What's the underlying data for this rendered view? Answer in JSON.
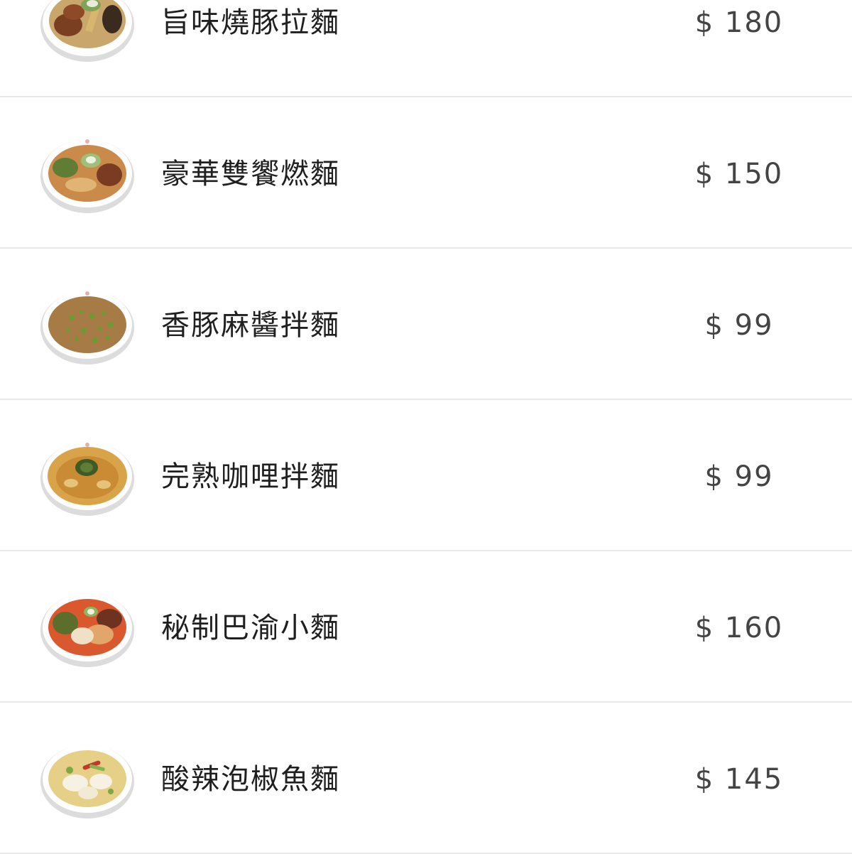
{
  "menu": {
    "items": [
      {
        "name": "旨味燒豚拉麵",
        "price": "$ 180",
        "image": "ramen-bowl-icon"
      },
      {
        "name": "豪華雙饗燃麵",
        "price": "$ 150",
        "image": "noodle-bowl-icon"
      },
      {
        "name": "香豚麻醬拌麵",
        "price": "$ 99",
        "image": "noodle-bowl-icon"
      },
      {
        "name": "完熟咖哩拌麵",
        "price": "$ 99",
        "image": "curry-noodle-bowl-icon"
      },
      {
        "name": "秘制巴渝小麵",
        "price": "$ 160",
        "image": "spicy-noodle-bowl-icon"
      },
      {
        "name": "酸辣泡椒魚麵",
        "price": "$ 145",
        "image": "fish-soup-bowl-icon"
      }
    ]
  },
  "colors": {
    "name_text": "#1f1f1f",
    "price_text": "#444444",
    "divider": "#e9e9e9",
    "background": "#ffffff"
  }
}
